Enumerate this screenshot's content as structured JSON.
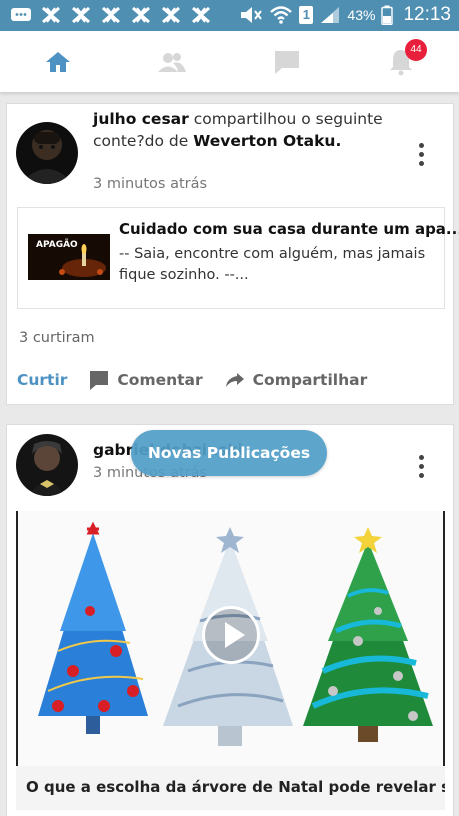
{
  "status_bar": {
    "battery_percent": "43%",
    "time": "12:13",
    "sim_label": "1",
    "colors": {
      "background": "#4f8fb2"
    }
  },
  "nav": {
    "tabs": [
      {
        "icon": "home-icon",
        "active": true
      },
      {
        "icon": "friends-icon",
        "active": false
      },
      {
        "icon": "messages-icon",
        "active": false
      },
      {
        "icon": "notifications-icon",
        "active": false
      }
    ],
    "notification_count": "44",
    "colors": {
      "active": "#4e92c4",
      "inactive": "#d7d7d7",
      "badge": "#e8203b"
    }
  },
  "post1": {
    "author": "julho cesar",
    "action_text": " compartilhou o seguinte conte?do de ",
    "source": "Weverton Otaku",
    "source_suffix": ".",
    "time": "3 minutos atrás",
    "shared": {
      "thumb_label": "APAGÃO",
      "title": "Cuidado com sua casa durante um apa...",
      "description": "-- Saia, encontre com alguém, mas jamais fique sozinho. --..."
    },
    "likes": "3 curtiram",
    "actions": {
      "like": "Curtir",
      "comment": "Comentar",
      "share": "Compartilhar"
    }
  },
  "post2": {
    "author": "gabriel dobzinski",
    "time": "3 minutos atrás",
    "caption": "O que a escolha da árvore de Natal pode revelar s..."
  },
  "new_posts_pill": "Novas Publicações"
}
